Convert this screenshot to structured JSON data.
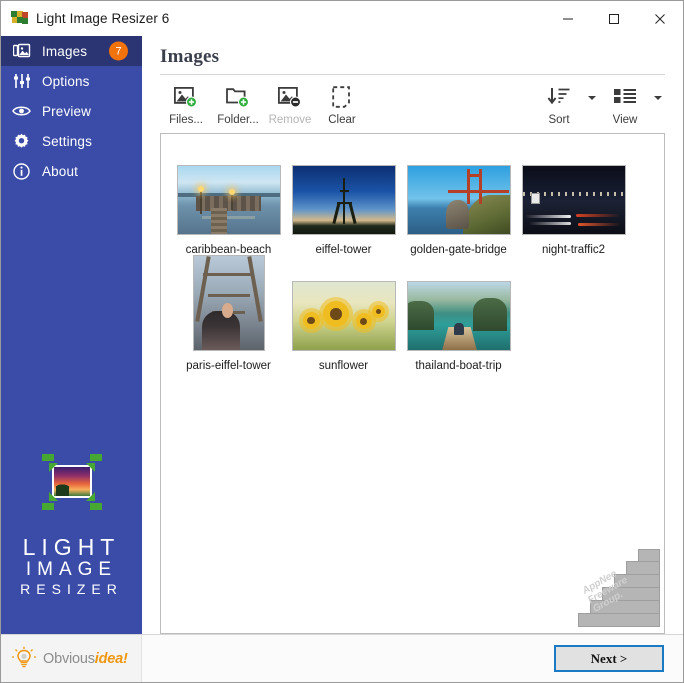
{
  "window": {
    "title": "Light Image Resizer 6",
    "app_icon": "app-logo-icon",
    "minimize_label": "Minimize",
    "maximize_label": "Maximize",
    "close_label": "Close"
  },
  "sidebar": {
    "items": [
      {
        "label": "Images",
        "icon": "images-icon",
        "badge": "7",
        "active": true
      },
      {
        "label": "Options",
        "icon": "sliders-icon",
        "badge": "",
        "active": false
      },
      {
        "label": "Preview",
        "icon": "eye-icon",
        "badge": "",
        "active": false
      },
      {
        "label": "Settings",
        "icon": "gear-icon",
        "badge": "",
        "active": false
      },
      {
        "label": "About",
        "icon": "info-icon",
        "badge": "",
        "active": false
      }
    ],
    "brand": {
      "line1": "LIGHT",
      "line2": "IMAGE",
      "line3": "RESIZER"
    },
    "colors": {
      "sidebar_bg": "#3b4ca8",
      "active_bg": "#2b3573",
      "badge_bg": "#f2720c"
    }
  },
  "main": {
    "page_title": "Images",
    "toolbar": {
      "left": [
        {
          "label": "Files...",
          "icon": "add-image-icon",
          "disabled": false
        },
        {
          "label": "Folder...",
          "icon": "add-folder-icon",
          "disabled": false
        },
        {
          "label": "Remove",
          "icon": "remove-image-icon",
          "disabled": true
        },
        {
          "label": "Clear",
          "icon": "clear-icon",
          "disabled": false
        }
      ],
      "right": [
        {
          "label": "Sort",
          "icon": "sort-descending-icon"
        },
        {
          "label": "View",
          "icon": "view-list-icon"
        }
      ]
    },
    "images": [
      {
        "name": "caribbean-beach",
        "orientation": "landscape"
      },
      {
        "name": "eiffel-tower",
        "orientation": "landscape"
      },
      {
        "name": "golden-gate-bridge",
        "orientation": "landscape"
      },
      {
        "name": "night-traffic2",
        "orientation": "landscape"
      },
      {
        "name": "paris-eiffel-tower",
        "orientation": "portrait"
      },
      {
        "name": "sunflower",
        "orientation": "landscape"
      },
      {
        "name": "thailand-boat-trip",
        "orientation": "landscape"
      }
    ],
    "watermark": {
      "line1": "AppNee",
      "line2": "Freeware",
      "line3": "Group."
    }
  },
  "footer": {
    "logo_text_primary": "Obvious",
    "logo_text_accent": "idea!",
    "next_label": "Next >"
  }
}
